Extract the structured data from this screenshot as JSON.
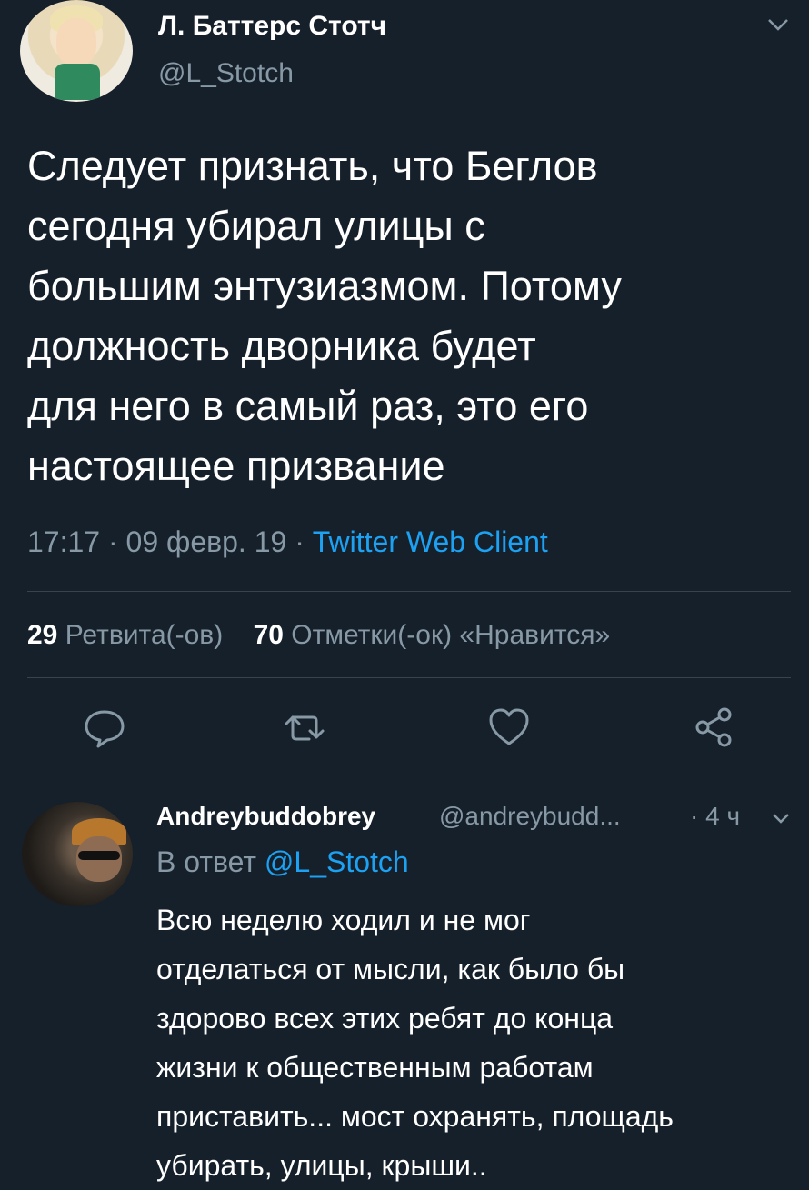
{
  "main_tweet": {
    "author_name": "Л. Баттерс Стотч",
    "handle": "@L_Stotch",
    "text": "Следует признать, что Беглов\nсегодня убирал улицы с\nбольшим энтузиазмом. Потому\nдолжность дворника будет\nдля него в самый раз, это его\nнастоящее призвание",
    "time": "17:17",
    "date": "09 февр. 19",
    "separator": "·",
    "client": "Twitter Web Client",
    "retweets_count": "29",
    "retweets_label": "Ретвита(-ов)",
    "likes_count": "70",
    "likes_label": "Отметки(-ок) «Нравится»"
  },
  "reply": {
    "author_name": "Andreybuddobrey",
    "handle": "@andreybudd...",
    "time_sep": "·",
    "time": "4 ч",
    "reply_prefix": "В ответ",
    "reply_mention": "@L_Stotch",
    "text": "Всю неделю ходил и не мог\nотделаться от мысли, как было бы\nздорово всех этих ребят до конца\nжизни к общественным работам\nприставить... мост охранять, площадь\nубирать, улицы, крыши.."
  },
  "icons": {
    "reply": "reply-icon",
    "retweet": "retweet-icon",
    "like": "heart-icon",
    "share": "share-icon",
    "menu": "chevron-down-icon"
  },
  "colors": {
    "background": "#15202b",
    "accent": "#1da1f2",
    "muted": "#8899a6",
    "divider": "#38444d"
  }
}
